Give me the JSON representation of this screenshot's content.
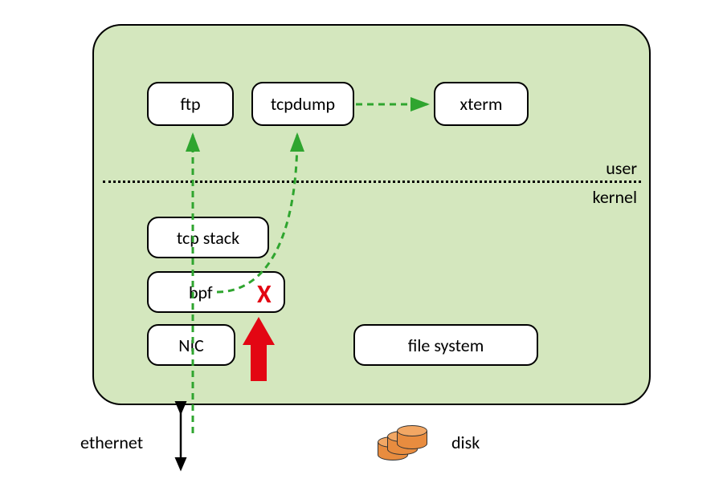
{
  "nodes": {
    "ftp": "ftp",
    "tcpdump": "tcpdump",
    "xterm": "xterm",
    "tcp_stack": "tcp stack",
    "bpf": "bpf",
    "nic": "NIC",
    "fs": "file system"
  },
  "labels": {
    "user": "user",
    "kernel": "kernel",
    "ethernet": "ethernet",
    "disk": "disk",
    "reject": "X"
  },
  "colors": {
    "panel": "#d4e7be",
    "arrow_green": "#2fa52f",
    "reject_red": "#e30613",
    "disk": "#e88c3f"
  }
}
